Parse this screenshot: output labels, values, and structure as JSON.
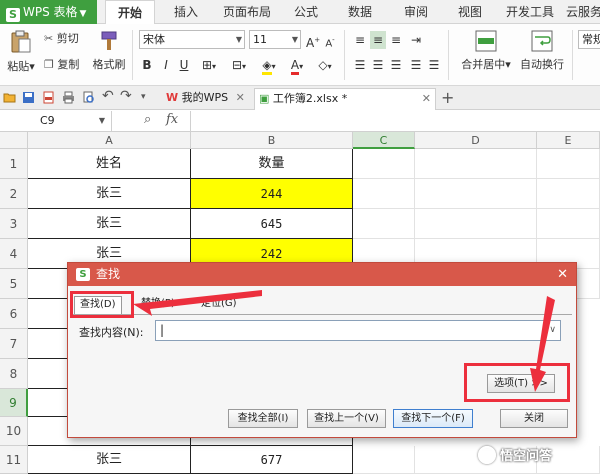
{
  "app": {
    "title": "WPS 表格",
    "logo": "S"
  },
  "menu": {
    "tabs": [
      "开始",
      "插入",
      "页面布局",
      "公式",
      "数据",
      "审阅",
      "视图",
      "开发工具",
      "云服务"
    ],
    "active": "开始"
  },
  "ribbon": {
    "paste_label": "粘贴",
    "cut_label": "剪切",
    "copy_label": "复制",
    "format_painter_label": "格式刷",
    "font_name": "宋体",
    "font_size": "11",
    "merge_center_label": "合并居中",
    "wrap_text_label": "自动换行",
    "general_label": "常规"
  },
  "doc_tabs": {
    "home": "我的WPS",
    "file": "工作簿2.xlsx *"
  },
  "formula_bar": {
    "cell_ref": "C9",
    "fx": "fx"
  },
  "sheet": {
    "columns": [
      "A",
      "B",
      "C",
      "D",
      "E"
    ],
    "rows": [
      "1",
      "2",
      "3",
      "4",
      "5",
      "6",
      "7",
      "8",
      "9",
      "10",
      "11"
    ],
    "header": [
      "姓名",
      "数量"
    ],
    "data": [
      [
        "张三",
        "244"
      ],
      [
        "张三",
        "645"
      ],
      [
        "张三",
        "242"
      ],
      [
        "张三",
        "677"
      ]
    ]
  },
  "dialog": {
    "title": "查找",
    "tabs": [
      "查找(D)",
      "替换(P)",
      "定位(G)"
    ],
    "find_label": "查找内容(N):",
    "find_value": "|",
    "options_label": "选项(T) >>",
    "find_all_label": "查找全部(I)",
    "find_prev_label": "查找上一个(V)",
    "find_next_label": "查找下一个(F)",
    "close_label": "关闭"
  },
  "watermark": "悟空问答",
  "colors": {
    "brand_green": "#3f9f3f",
    "dialog_title": "#d8584a",
    "highlight_red": "#ec2f3d",
    "cell_yellow": "#ffff00"
  }
}
